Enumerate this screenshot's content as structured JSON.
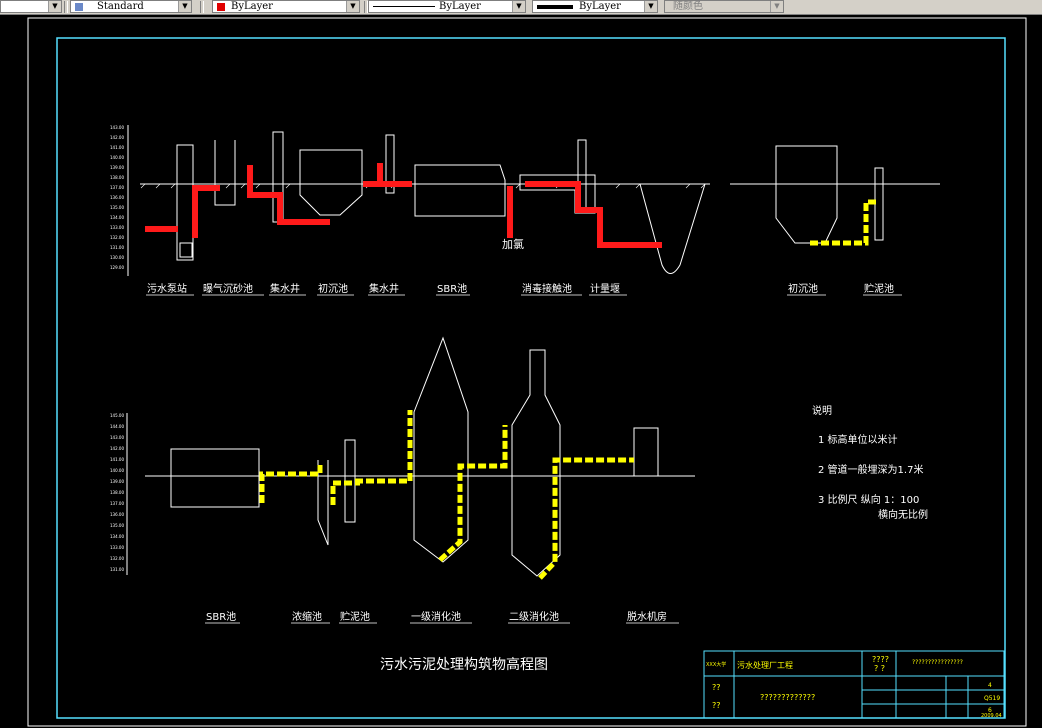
{
  "toolbar": {
    "text_style": "Standard",
    "layer_color": "ByLayer",
    "linetype": "ByLayer",
    "lineweight": "ByLayer",
    "plot_style": "随颜色"
  },
  "colors": {
    "background": "#000000",
    "frame": "#55e0ff",
    "lines": "#ffffff",
    "water_pipe": "#ff1a1a",
    "sludge_pipe": "#ffff00",
    "title_block_text": "#ffff00"
  },
  "drawing": {
    "title": "污水污泥处理构筑物高程图",
    "top_labels": [
      "污水泵站",
      "曝气沉砂池",
      "集水井",
      "初沉池",
      "集水井",
      "SBR池",
      "消毒接触池",
      "计量堰",
      "初沉池",
      "贮泥池"
    ],
    "bottom_labels": [
      "SBR池",
      "浓缩池",
      "贮泥池",
      "一级消化池",
      "二级消化池",
      "脱水机房"
    ],
    "chlorine_label": "加氯",
    "notes_title": "说明",
    "notes": [
      "1 标高单位以米计",
      "2 管道一般埋深为1.7米",
      "3 比例尺  纵向 1：100",
      "横向无比例"
    ]
  },
  "title_block": {
    "school": "XXX大学",
    "project": "污水处理厂工程",
    "cell_a": "????",
    "cell_b": "? ?",
    "cell_c": "??",
    "cell_d": "??",
    "cell_e": "????????????????",
    "cell_f": "?????????????",
    "right_top": "????????????????",
    "code1": "4",
    "code2": "Q519",
    "code3": "6",
    "date": "2009.04"
  }
}
